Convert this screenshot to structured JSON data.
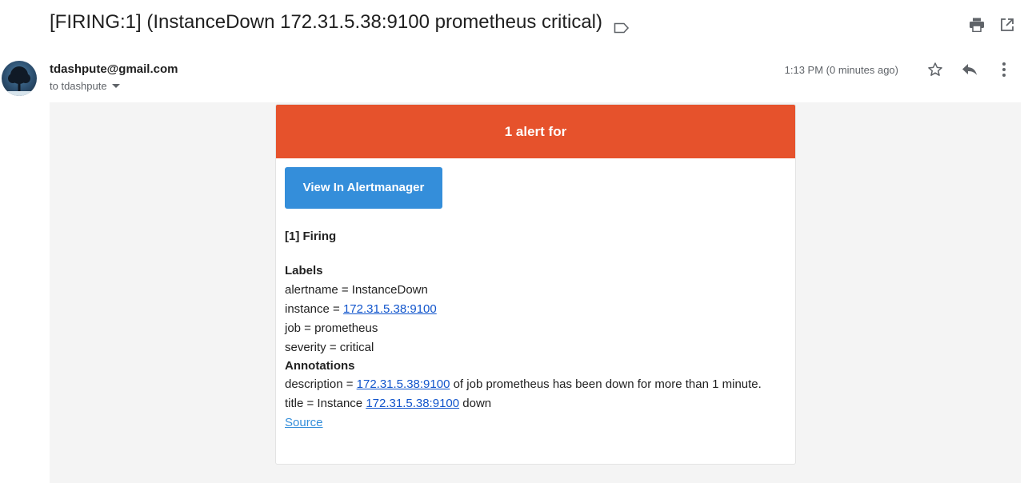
{
  "email": {
    "subject": "[FIRING:1] (InstanceDown 172.31.5.38:9100 prometheus critical)",
    "sender": "tdashpute@gmail.com",
    "to": "to tdashpute",
    "time": "1:13 PM (0 minutes ago)"
  },
  "alert": {
    "banner": "1 alert for",
    "button_label": "View In Alertmanager",
    "firing_heading": "[1] Firing",
    "labels_heading": "Labels",
    "alertname_text": "alertname = InstanceDown",
    "instance_prefix": "instance = ",
    "instance_value": "172.31.5.38:9100",
    "job_text": "job = prometheus",
    "severity_text": "severity = critical",
    "annotations_heading": "Annotations",
    "description_prefix": "description = ",
    "description_link": "172.31.5.38:9100",
    "description_suffix": " of job prometheus has been down for more than 1 minute.",
    "title_prefix": "title = Instance ",
    "title_link": "172.31.5.38:9100",
    "title_suffix": " down",
    "source_label": "Source"
  },
  "icons": {
    "label": "label-icon",
    "print": "print-icon",
    "popout": "open-in-new-icon",
    "star": "star-icon",
    "reply": "reply-icon",
    "more": "more-vert-icon",
    "caret": "caret-down-icon"
  },
  "colors": {
    "banner": "#e6522c",
    "button": "#348eda",
    "link": "#1155cc"
  }
}
